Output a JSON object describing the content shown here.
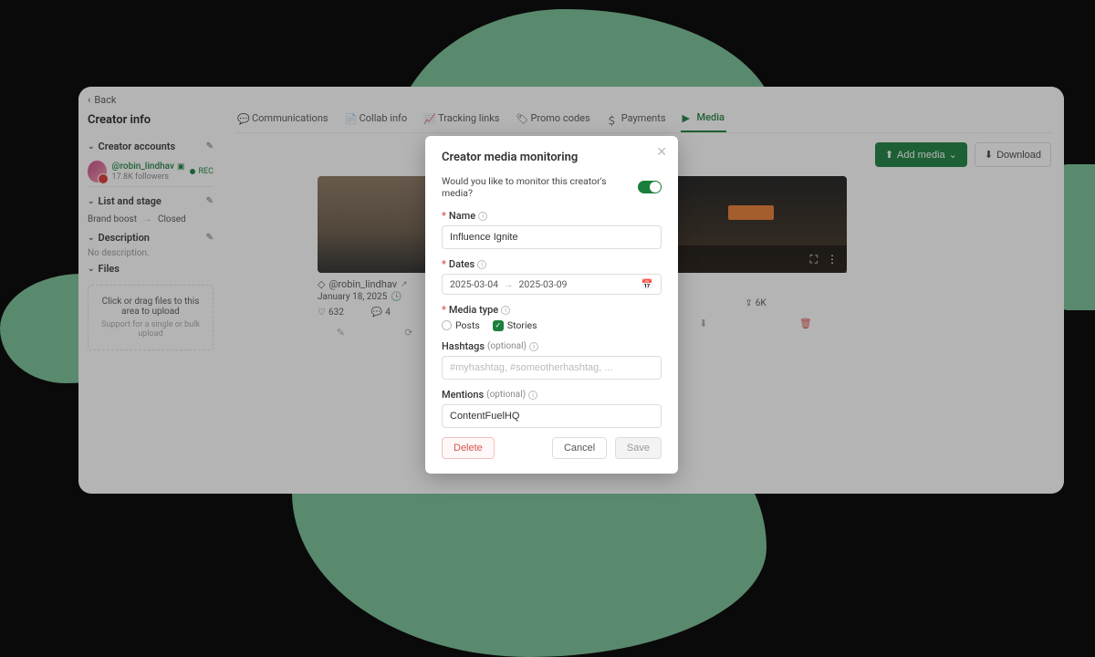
{
  "back_label": "Back",
  "page_title": "Creator info",
  "sections": {
    "accounts_label": "Creator accounts",
    "list_stage_label": "List and stage",
    "description_label": "Description",
    "files_label": "Files"
  },
  "creator": {
    "handle": "@robin_lindhav",
    "followers": "17.8K followers",
    "rec_label": "REC"
  },
  "stage": {
    "from": "Brand boost",
    "to": "Closed"
  },
  "description_text": "No description.",
  "upload": {
    "main": "Click or drag files to this area to upload",
    "sub": "Support for a single or bulk upload"
  },
  "tabs": {
    "communications": "Communications",
    "collab": "Collab info",
    "tracking": "Tracking links",
    "promo": "Promo codes",
    "payments": "Payments",
    "media": "Media"
  },
  "actions": {
    "add_media": "Add media",
    "download": "Download"
  },
  "media1": {
    "handle": "@robin_lindhav",
    "date": "January 18, 2025",
    "likes": "632",
    "comments": "4"
  },
  "media2": {
    "shares": "6K"
  },
  "modal": {
    "title": "Creator media monitoring",
    "monitor_q": "Would you like to monitor this creator's media?",
    "name_label": "Name",
    "name_value": "Influence Ignite",
    "dates_label": "Dates",
    "date_from": "2025-03-04",
    "date_to": "2025-03-09",
    "media_type_label": "Media type",
    "posts_label": "Posts",
    "stories_label": "Stories",
    "hashtags_label": "Hashtags",
    "hashtags_placeholder": "#myhashtag, #someotherhashtag, ...",
    "mentions_label": "Mentions",
    "mentions_value": "ContentFuelHQ",
    "optional": "(optional)",
    "delete": "Delete",
    "cancel": "Cancel",
    "save": "Save"
  }
}
